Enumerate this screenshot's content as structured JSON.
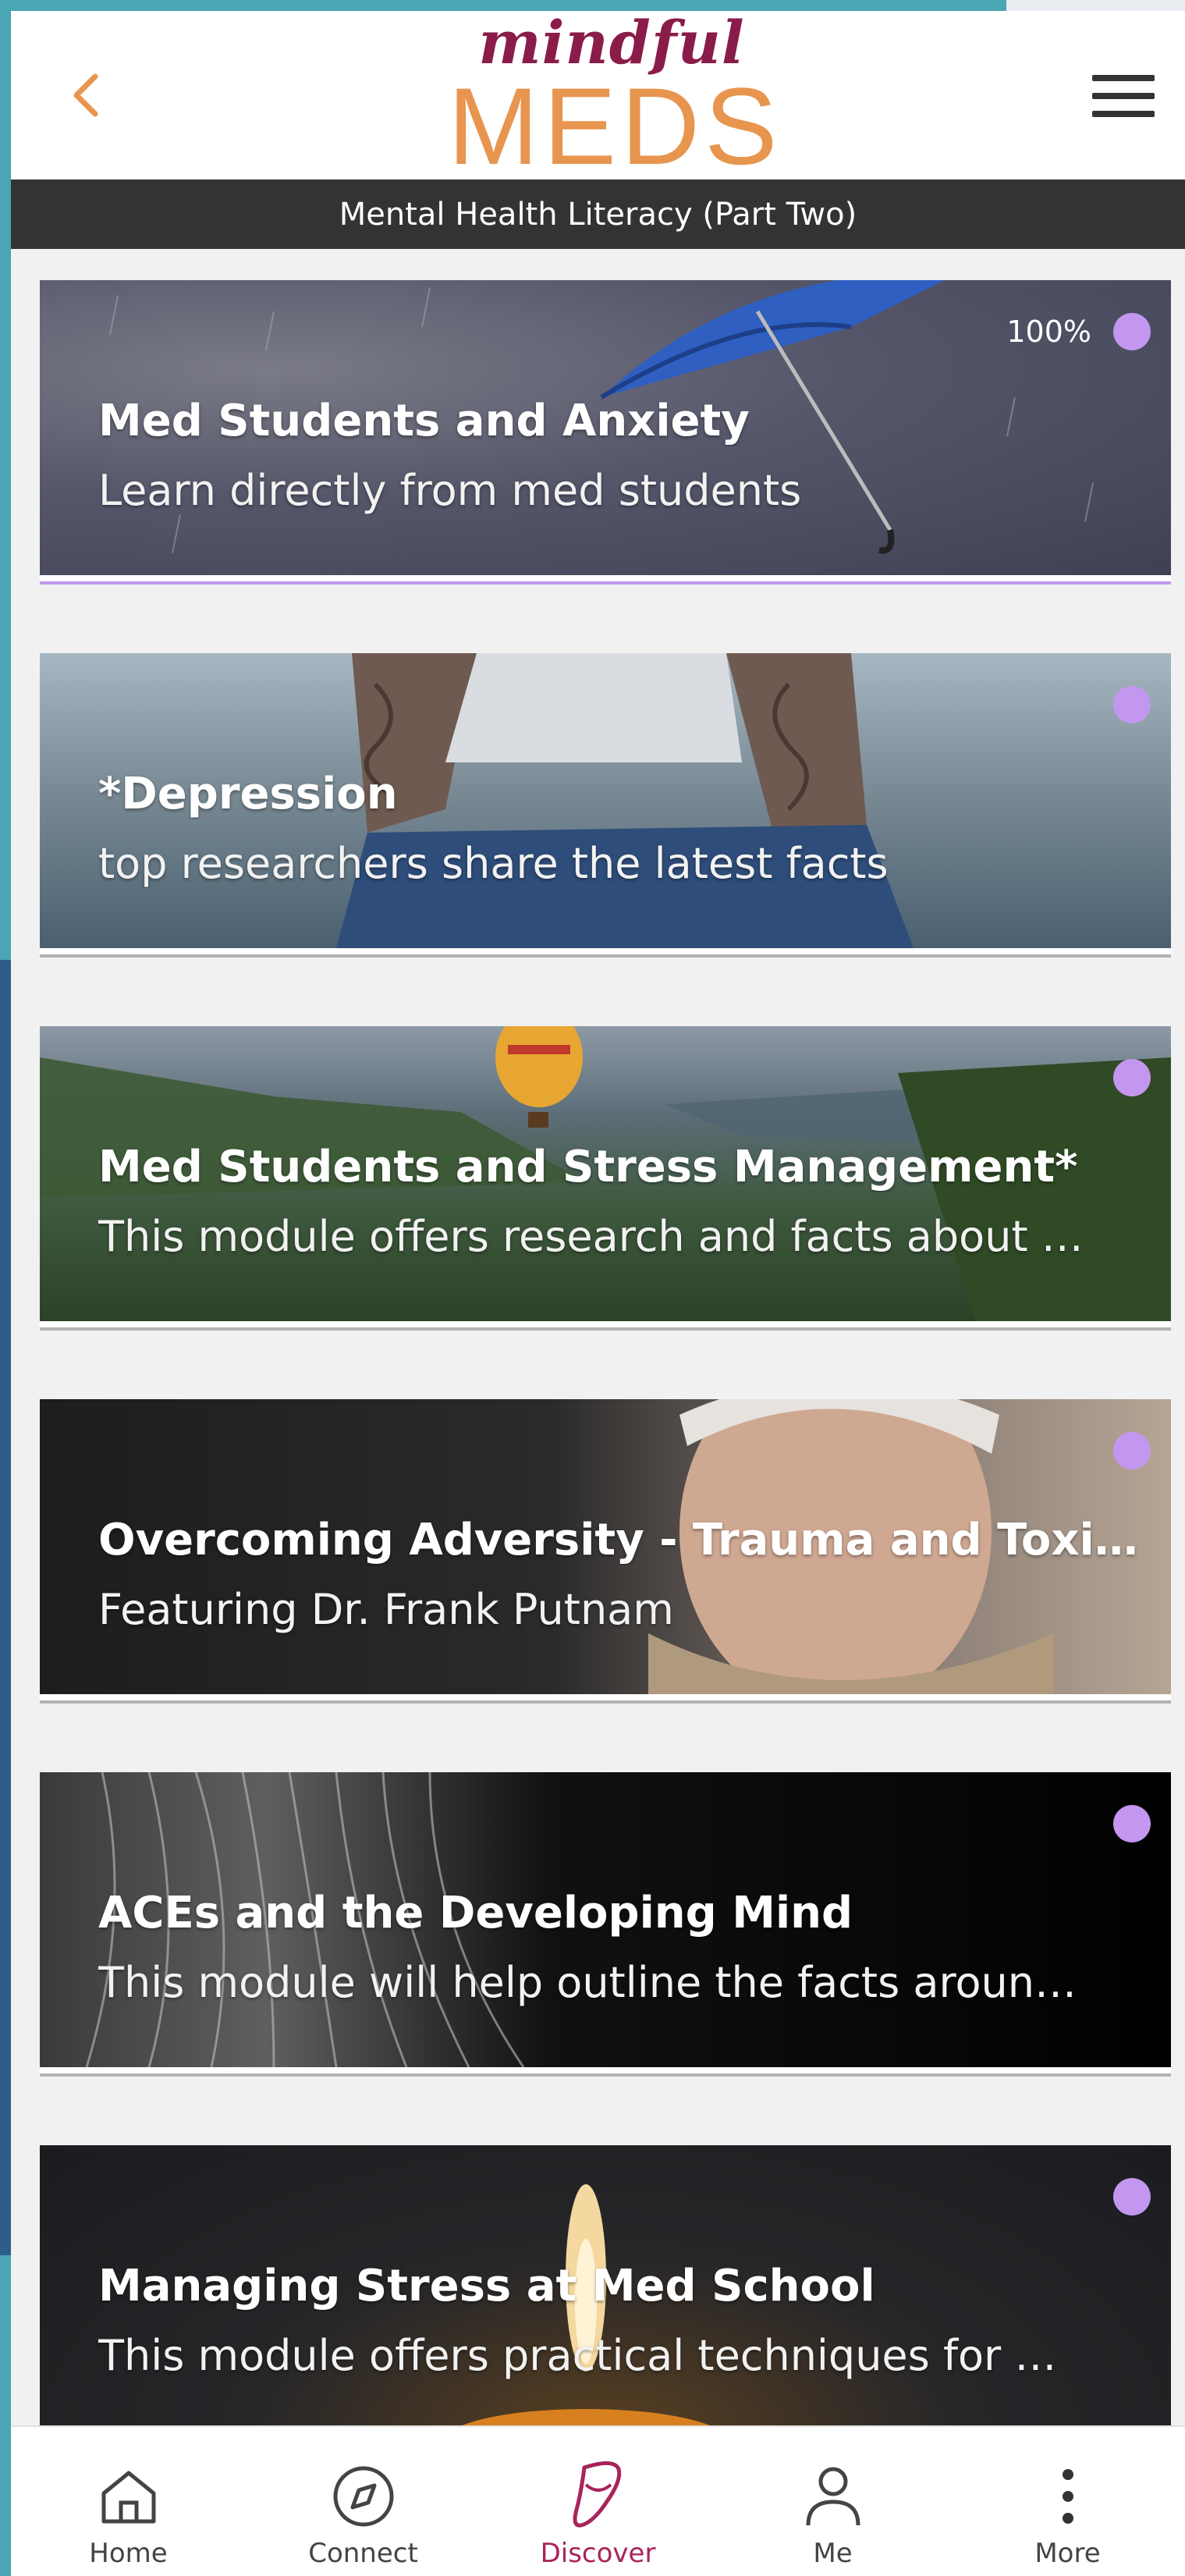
{
  "header": {
    "logo_script": "mindful",
    "logo_main": "MEDS",
    "logo_script_color": "#8a1c4a",
    "logo_main_color": "#e8954f",
    "back_icon": "chevron-left-icon",
    "menu_icon": "hamburger-menu-icon"
  },
  "section": {
    "title": "Mental Health Literacy (Part Two)"
  },
  "modules": [
    {
      "title": "Med Students and Anxiety",
      "subtitle": "Learn directly from med students",
      "progress_label": "100%",
      "progress": 1.0
    },
    {
      "title": "*Depression",
      "subtitle": "top researchers share the latest facts",
      "progress": 0
    },
    {
      "title": "Med Students and Stress Management*",
      "subtitle": "This module offers research and facts about …",
      "progress": 0
    },
    {
      "title": "Overcoming Adversity - Trauma and Toxic Str…",
      "subtitle": "Featuring Dr. Frank Putnam",
      "progress": 0
    },
    {
      "title": "ACEs and the Developing Mind",
      "subtitle": "This module will help outline the facts aroun…",
      "progress": 0
    },
    {
      "title": "Managing Stress at Med School",
      "subtitle": "This module offers practical techniques for …",
      "progress": 0
    }
  ],
  "colors": {
    "accent": "#c397f0",
    "active_nav": "#a8245a",
    "progress_track": "#b2b2b2"
  },
  "bottom_nav": [
    {
      "label": "Home",
      "icon": "home-icon"
    },
    {
      "label": "Connect",
      "icon": "compass-icon"
    },
    {
      "label": "Discover",
      "icon": "discover-icon",
      "active": true
    },
    {
      "label": "Me",
      "icon": "user-icon"
    },
    {
      "label": "More",
      "icon": "more-vertical-icon"
    }
  ]
}
